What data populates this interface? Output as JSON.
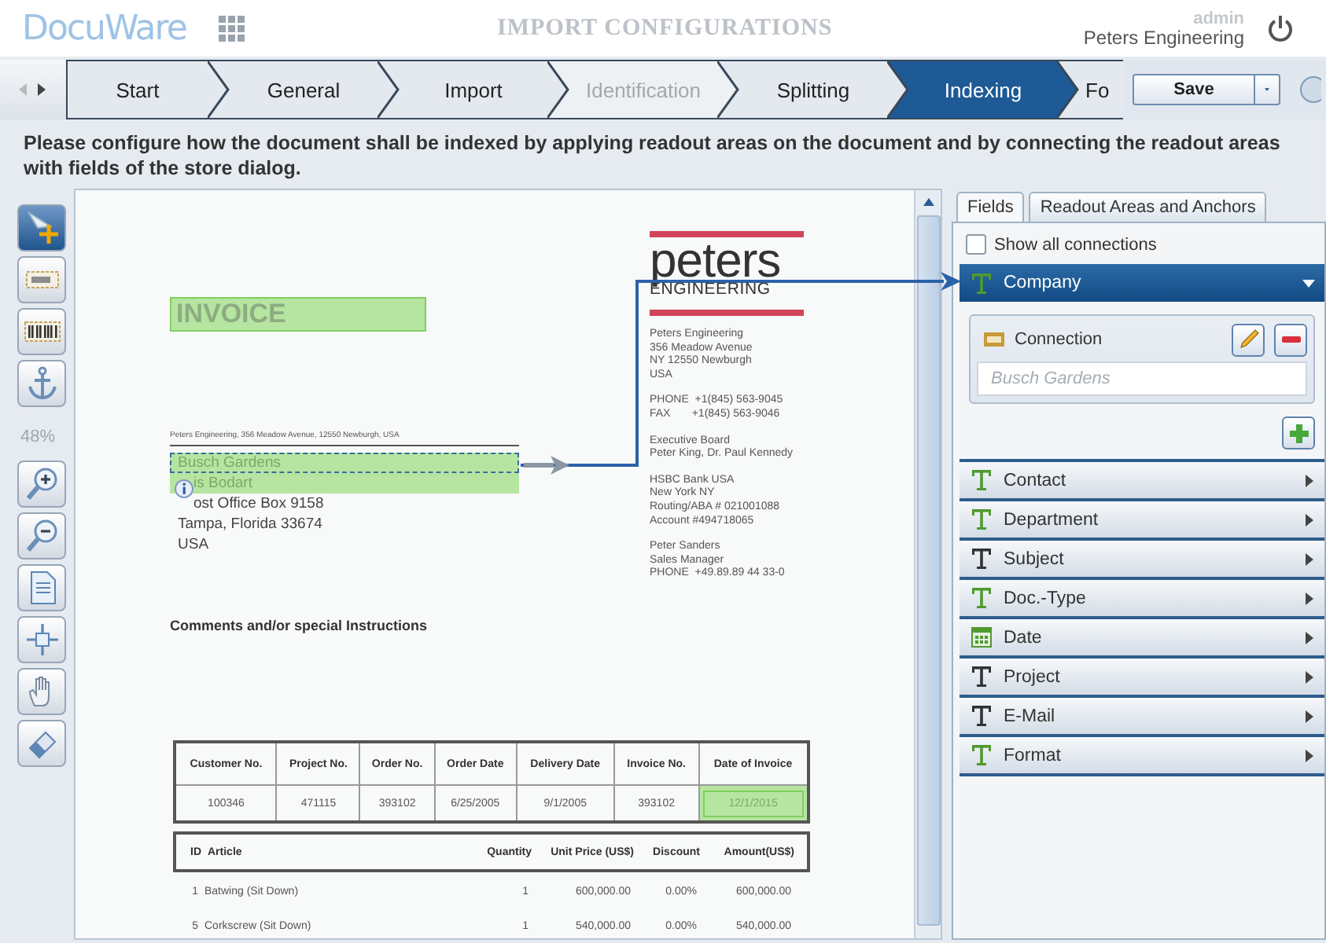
{
  "header": {
    "logo": "DocuWare",
    "title": "IMPORT CONFIGURATIONS",
    "user": "admin",
    "organization": "Peters Engineering"
  },
  "steps": [
    {
      "label": "Start",
      "selected": false,
      "disabled": false
    },
    {
      "label": "General",
      "selected": false,
      "disabled": false
    },
    {
      "label": "Import",
      "selected": false,
      "disabled": false
    },
    {
      "label": "Identification",
      "selected": false,
      "disabled": true
    },
    {
      "label": "Splitting",
      "selected": false,
      "disabled": false
    },
    {
      "label": "Indexing",
      "selected": true,
      "disabled": false
    },
    {
      "label": "Fo",
      "selected": false,
      "disabled": false
    }
  ],
  "save_button": {
    "label": "Save"
  },
  "instruction": "Please configure how the document shall be indexed by applying readout areas on the document and by connecting the readout areas with fields of the store dialog.",
  "zone_tools": [
    {
      "kind": "select",
      "selected": true
    },
    {
      "kind": "text-zone",
      "selected": false
    },
    {
      "kind": "barcode-zone",
      "selected": false
    },
    {
      "kind": "anchor",
      "selected": false
    }
  ],
  "zoom": "48%",
  "view_tools": [
    {
      "kind": "zoom-in",
      "selected": false
    },
    {
      "kind": "zoom-out",
      "selected": false
    },
    {
      "kind": "fit-page",
      "selected": false
    },
    {
      "kind": "move",
      "selected": false
    },
    {
      "kind": "hand",
      "selected": false
    },
    {
      "kind": "eraser",
      "selected": false
    }
  ],
  "document": {
    "title": {
      "text": "INVOICE",
      "readout": true
    },
    "sender_line": "Peters Engineering, 356 Meadow Avenue,  12550 Newburgh, USA",
    "recipient": [
      {
        "text": "Busch Gardens",
        "readout": true,
        "selected": true
      },
      {
        "text": "is Bodart",
        "readout": true,
        "selected": false
      },
      {
        "text": "ost Office Box 9158",
        "readout": false,
        "selected": false
      },
      {
        "text": "Tampa, Florida  33674",
        "readout": false,
        "selected": false
      },
      {
        "text": "USA",
        "readout": false,
        "selected": false
      }
    ],
    "comments_heading": "Comments and/or special Instructions",
    "logo": {
      "word": "peters",
      "subword": "ENGINEERING"
    },
    "company_info": [
      {
        "lines": [
          "Peters Engineering",
          "356 Meadow Avenue",
          "NY 12550 Newburgh",
          "USA"
        ]
      },
      {
        "lines": [
          "PHONE  +1(845) 563-9045",
          "FAX       +1(845) 563-9046"
        ]
      },
      {
        "lines": [
          "Executive Board",
          "Peter King, Dr. Paul Kennedy"
        ]
      },
      {
        "lines": [
          "HSBC Bank USA",
          "New York NY",
          "Routing/ABA # 021001088",
          "Account #494718065"
        ]
      },
      {
        "lines": [
          "Peter Sanders",
          "Sales Manager",
          "PHONE  +49.89.89 44 33-0"
        ]
      }
    ],
    "order_table": {
      "columns": [
        "Customer No.",
        "Project No.",
        "Order No.",
        "Order Date",
        "Delivery Date",
        "Invoice No.",
        "Date of Invoice"
      ],
      "row": [
        {
          "text": "100346",
          "readout": false
        },
        {
          "text": "471115",
          "readout": false
        },
        {
          "text": "393102",
          "readout": false
        },
        {
          "text": "6/25/2005",
          "readout": false
        },
        {
          "text": "9/1/2005",
          "readout": false
        },
        {
          "text": "393102",
          "readout": false
        },
        {
          "text": "12/1/2015",
          "readout": true
        }
      ]
    },
    "items_table": {
      "columns": [
        "ID",
        "Article",
        "Quantity",
        "Unit Price (US$)",
        "Discount",
        "Amount(US$)"
      ],
      "rows": [
        [
          "1",
          "Batwing (Sit Down)",
          "1",
          "600,000.00",
          "0.00%",
          "600,000.00"
        ],
        [
          "5",
          "Corkscrew (Sit Down)",
          "1",
          "540,000.00",
          "0.00%",
          "540,000.00"
        ]
      ]
    }
  },
  "panel_tabs": [
    {
      "label": "Fields",
      "selected": true
    },
    {
      "label": "Readout Areas and Anchors",
      "selected": false
    }
  ],
  "show_all_connections": {
    "label": "Show all connections",
    "checked": false
  },
  "fields": [
    {
      "label": "Company",
      "kind": "text",
      "color": "#4f9a2f",
      "expanded": true,
      "connections": [
        {
          "label": "Connection",
          "placeholder": "Busch Gardens"
        }
      ]
    },
    {
      "label": "Contact",
      "kind": "text",
      "color": "#4f9a2f",
      "expanded": false
    },
    {
      "label": "Department",
      "kind": "text",
      "color": "#4f9a2f",
      "expanded": false
    },
    {
      "label": "Subject",
      "kind": "text",
      "color": "#333333",
      "expanded": false
    },
    {
      "label": "Doc.-Type",
      "kind": "text",
      "color": "#4f9a2f",
      "expanded": false
    },
    {
      "label": "Date",
      "kind": "date",
      "color": "#4f9a2f",
      "expanded": false
    },
    {
      "label": "Project",
      "kind": "text",
      "color": "#333333",
      "expanded": false
    },
    {
      "label": "E-Mail",
      "kind": "text",
      "color": "#333333",
      "expanded": false
    },
    {
      "label": "Format",
      "kind": "text",
      "color": "#4f9a2f",
      "expanded": false
    }
  ]
}
